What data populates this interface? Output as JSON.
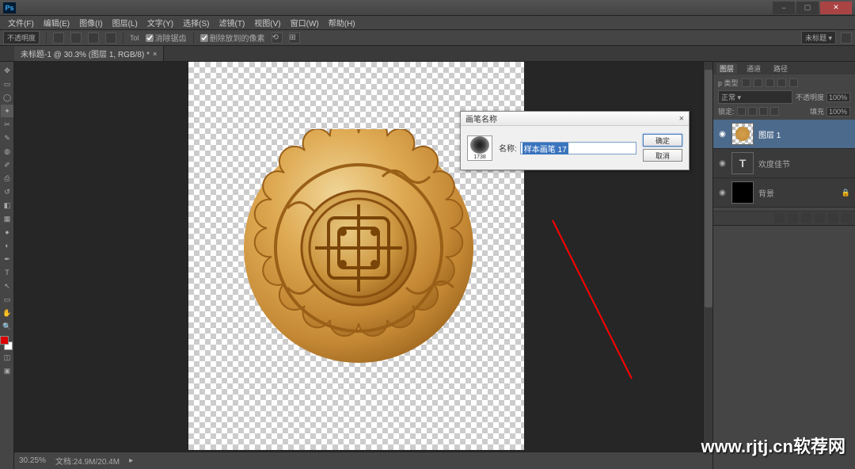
{
  "app": {
    "logo": "Ps"
  },
  "window": {
    "minimize": "−",
    "maximize": "▢",
    "close": "✕"
  },
  "menu": [
    "文件(F)",
    "编辑(E)",
    "图像(I)",
    "图层(L)",
    "文字(Y)",
    "选择(S)",
    "滤镜(T)",
    "视图(V)",
    "窗口(W)",
    "帮助(H)"
  ],
  "options": {
    "feather": "不透明度",
    "anti_alias": "消除锯齿",
    "refine": "删除放到的像素",
    "right_label": "未标题",
    "scrub": "⟲",
    "zoom": "⊞"
  },
  "doctab": {
    "title": "未标题-1 @ 30.3% (图层 1, RGB/8) *",
    "close": "×"
  },
  "dialog": {
    "title": "画笔名称",
    "brush_size": "1738",
    "name_label": "名称:",
    "name_value": "样本画笔 17",
    "ok": "确定",
    "cancel": "取消",
    "close": "×"
  },
  "panels": {
    "tab_layers": "图层",
    "tab_channels": "通道",
    "tab_paths": "路径",
    "kind_label": "p 类型",
    "blend_mode": "正常",
    "opacity_label": "不透明度",
    "opacity_value": "100%",
    "lock_label": "锁定:",
    "fill_label": "填充",
    "fill_value": "100%",
    "layers": [
      {
        "name": "图层 1",
        "visible": "◉",
        "type": "image",
        "selected": true
      },
      {
        "name": "欢度佳节",
        "visible": "◉",
        "type": "text",
        "selected": false,
        "thumb": "T"
      },
      {
        "name": "背景",
        "visible": "◉",
        "type": "bg",
        "selected": false,
        "locked": "🔒"
      }
    ]
  },
  "status": {
    "zoom": "30.25%",
    "docsize": "文档:24.9M/20.4M",
    "arrow": "▸"
  },
  "watermark": "www.rjtj.cn软荐网"
}
